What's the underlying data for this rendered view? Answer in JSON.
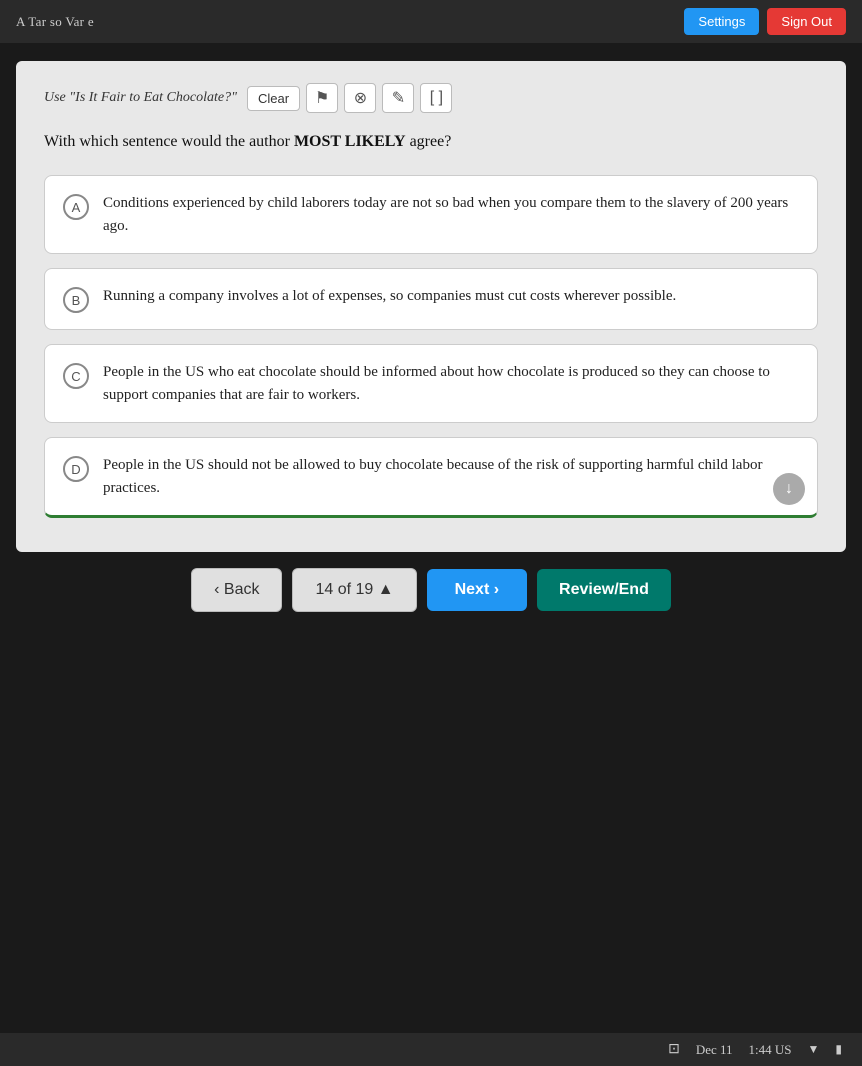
{
  "topbar": {
    "title": "A Tar so Var e",
    "settings_label": "Settings",
    "signout_label": "Sign Out"
  },
  "toolbar": {
    "article_label": "Use \"Is It Fair to Eat Chocolate?\"",
    "clear_label": "Clear",
    "flag_icon": "⚑",
    "x_icon": "⊗",
    "edit_icon": "✎",
    "expand_icon": "[ ]"
  },
  "question": {
    "text": "With which sentence would the author ",
    "emphasis": "MOST LIKELY",
    "text_after": " agree?"
  },
  "options": [
    {
      "letter": "A",
      "text": "Conditions experienced by child laborers today are not so bad when you compare them to the slavery of 200 years ago."
    },
    {
      "letter": "B",
      "text": "Running a company involves a lot of expenses, so companies must cut costs wherever possible."
    },
    {
      "letter": "C",
      "text": "People in the US who eat chocolate should be informed about how chocolate is produced so they can choose to support companies that are fair to workers."
    },
    {
      "letter": "D",
      "text": "People in the US should not be allowed to buy chocolate because of the risk of supporting harmful child labor practices."
    }
  ],
  "navigation": {
    "back_label": "‹ Back",
    "progress_label": "14 of 19 ▲",
    "next_label": "Next ›",
    "review_label": "Review/End"
  },
  "statusbar": {
    "date": "Dec 11",
    "time": "1:44 US",
    "wifi_icon": "▼",
    "battery_icon": "▮"
  }
}
